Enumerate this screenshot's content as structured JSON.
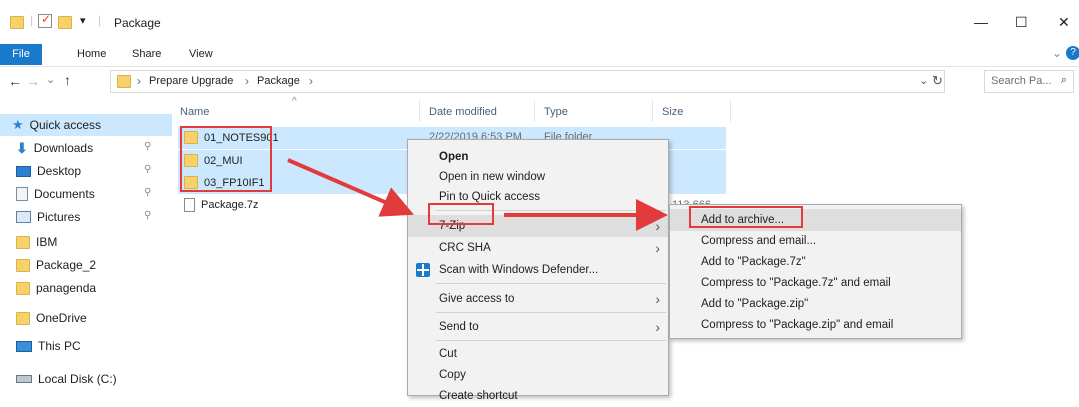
{
  "window": {
    "title": "Package",
    "qat_down": "▾",
    "controls": {
      "minimize": "—",
      "maximize": "☐",
      "close": "✕"
    }
  },
  "ribbon": {
    "tabs": [
      "File",
      "Home",
      "Share",
      "View"
    ],
    "expand": "⌄",
    "help": "?"
  },
  "nav": {
    "back": "←",
    "forward": "→",
    "recent": "⌄",
    "up": "↑",
    "refresh": "↻",
    "dropdown": "⌄"
  },
  "address": {
    "sep": "›",
    "crumbs": [
      "Prepare Upgrade",
      "Package"
    ]
  },
  "search": {
    "placeholder": "Search Pa...",
    "icon": "⌕"
  },
  "sidebar": {
    "items": [
      {
        "label": "Quick access",
        "icon": "star-icon"
      },
      {
        "label": "Downloads",
        "icon": "download-arrow-icon",
        "pinned": true
      },
      {
        "label": "Desktop",
        "icon": "desktop-icon",
        "pinned": true
      },
      {
        "label": "Documents",
        "icon": "documents-icon",
        "pinned": true
      },
      {
        "label": "Pictures",
        "icon": "pictures-icon",
        "pinned": true
      },
      {
        "label": "IBM",
        "icon": "folder-icon"
      },
      {
        "label": "Package_2",
        "icon": "folder-icon"
      },
      {
        "label": "panagenda",
        "icon": "folder-icon"
      },
      {
        "label": "OneDrive",
        "icon": "folder-icon"
      },
      {
        "label": "This PC",
        "icon": "monitor-icon"
      },
      {
        "label": "Local Disk (C:)",
        "icon": "drive-icon"
      }
    ],
    "pin_glyph": "📌"
  },
  "file_list": {
    "sort_glyph": "^",
    "columns": [
      "Name",
      "Date modified",
      "Type",
      "Size"
    ],
    "rows": [
      {
        "name": "01_NOTES901",
        "date": "2/22/2019 6:53 PM",
        "type": "File folder",
        "size": "",
        "selected": true
      },
      {
        "name": "02_MUI",
        "date": "",
        "type": "",
        "size": "",
        "selected": true
      },
      {
        "name": "03_FP10IF1",
        "date": "",
        "type": "",
        "size": "",
        "selected": true
      },
      {
        "name": "Package.7z",
        "date": "",
        "type": "",
        "size": "113,666 KB",
        "selected": false
      }
    ]
  },
  "context_menu": {
    "items": [
      "Open",
      "Open in new window",
      "Pin to Quick access",
      "7-Zip",
      "CRC SHA",
      "Scan with Windows Defender...",
      "Give access to",
      "Send to",
      "Cut",
      "Copy",
      "Create shortcut"
    ],
    "chevron": "›"
  },
  "submenu_7zip": {
    "items": [
      "Add to archive...",
      "Compress and email...",
      "Add to \"Package.7z\"",
      "Compress to \"Package.7z\" and email",
      "Add to \"Package.zip\"",
      "Compress to \"Package.zip\" and email"
    ]
  },
  "colors": {
    "accent": "#1979ca",
    "selection": "#cce8ff",
    "annotation": "#e23b3b",
    "folder": "#f7d26b"
  }
}
